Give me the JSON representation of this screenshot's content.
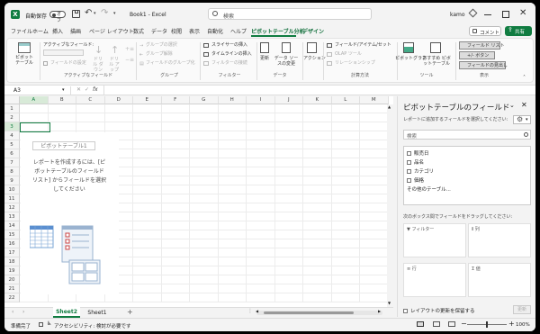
{
  "titlebar": {
    "autosave_label": "自動保存",
    "autosave_state": "オフ",
    "doc_title": "Book1 - Excel",
    "search_placeholder": "検索",
    "user": "kamo"
  },
  "tabs": [
    "ファイル",
    "ホーム",
    "挿入",
    "描画",
    "ページ レイアウト",
    "数式",
    "データ",
    "校閲",
    "表示",
    "自動化",
    "ヘルプ",
    "ピボットテーブル分析",
    "デザイン"
  ],
  "right_buttons": {
    "comment": "コメント",
    "share": "共有"
  },
  "ribbon": {
    "pivot_label": "ピボット テーブル",
    "active_field_label": "アクティブなフィールド:",
    "field_settings": "フィールドの設定",
    "drilldown": "ドリル ダウン",
    "drillup": "ドリル アップ",
    "group_selection": "グループの選択",
    "ungroup": "グループ解除",
    "group_field": "フィールドのグループ化",
    "slicer": "スライサーの挿入",
    "timeline": "タイムラインの挿入",
    "filter_conn": "フィルターの接続",
    "refresh": "更新",
    "change_source": "データ ソースの変更",
    "action": "アクション",
    "fields_items": "フィールド/アイテム/セット",
    "olap": "OLAP ツール",
    "relationships": "リレーションシップ",
    "pivot_chart": "ピボットグラフ",
    "recommended": "おすすめ ピボットテーブル",
    "field_list": "フィールド リスト",
    "buttons": "+/- ボタン",
    "headers": "フィールドの見出し",
    "groups": [
      "アクティブなフィールド",
      "グループ",
      "フィルター",
      "データ",
      "計算方法",
      "ツール",
      "表示"
    ]
  },
  "formula": {
    "namebox": "A3",
    "fx": "fx"
  },
  "columns": [
    "A",
    "B",
    "C",
    "D",
    "E",
    "F",
    "G",
    "H",
    "I",
    "J",
    "K",
    "L",
    "M"
  ],
  "rows": [
    "1",
    "2",
    "3",
    "4",
    "5",
    "6",
    "7",
    "8",
    "9",
    "10",
    "11",
    "12",
    "13",
    "14",
    "15",
    "16",
    "17",
    "18",
    "19",
    "20",
    "21",
    "22"
  ],
  "placeholder": {
    "title": "ピボットテーブル1",
    "line1": "レポートを作成するには、[ピ",
    "line2": "ボットテーブルのフィールド",
    "line3": "リスト] からフィールドを選択",
    "line4": "してください"
  },
  "pane": {
    "title": "ピボットテーブルのフィールド",
    "subtitle": "レポートに追加するフィールドを選択してください:",
    "search_placeholder": "検索",
    "fields": [
      "販売日",
      "品名",
      "カテゴリ",
      "価格"
    ],
    "more": "その他のテーブル...",
    "drag_hint": "次のボックス間でフィールドをドラッグしてください:",
    "areas": {
      "filter": "フィルター",
      "columns": "列",
      "rows": "行",
      "values": "値"
    },
    "defer": "レイアウトの更新を保留する",
    "update": "更新"
  },
  "sheets": {
    "active": "Sheet2",
    "other": "Sheet1"
  },
  "status": {
    "ready": "準備完了",
    "accessibility": "アクセシビリティ: 検討が必要です",
    "zoom": "100%"
  }
}
